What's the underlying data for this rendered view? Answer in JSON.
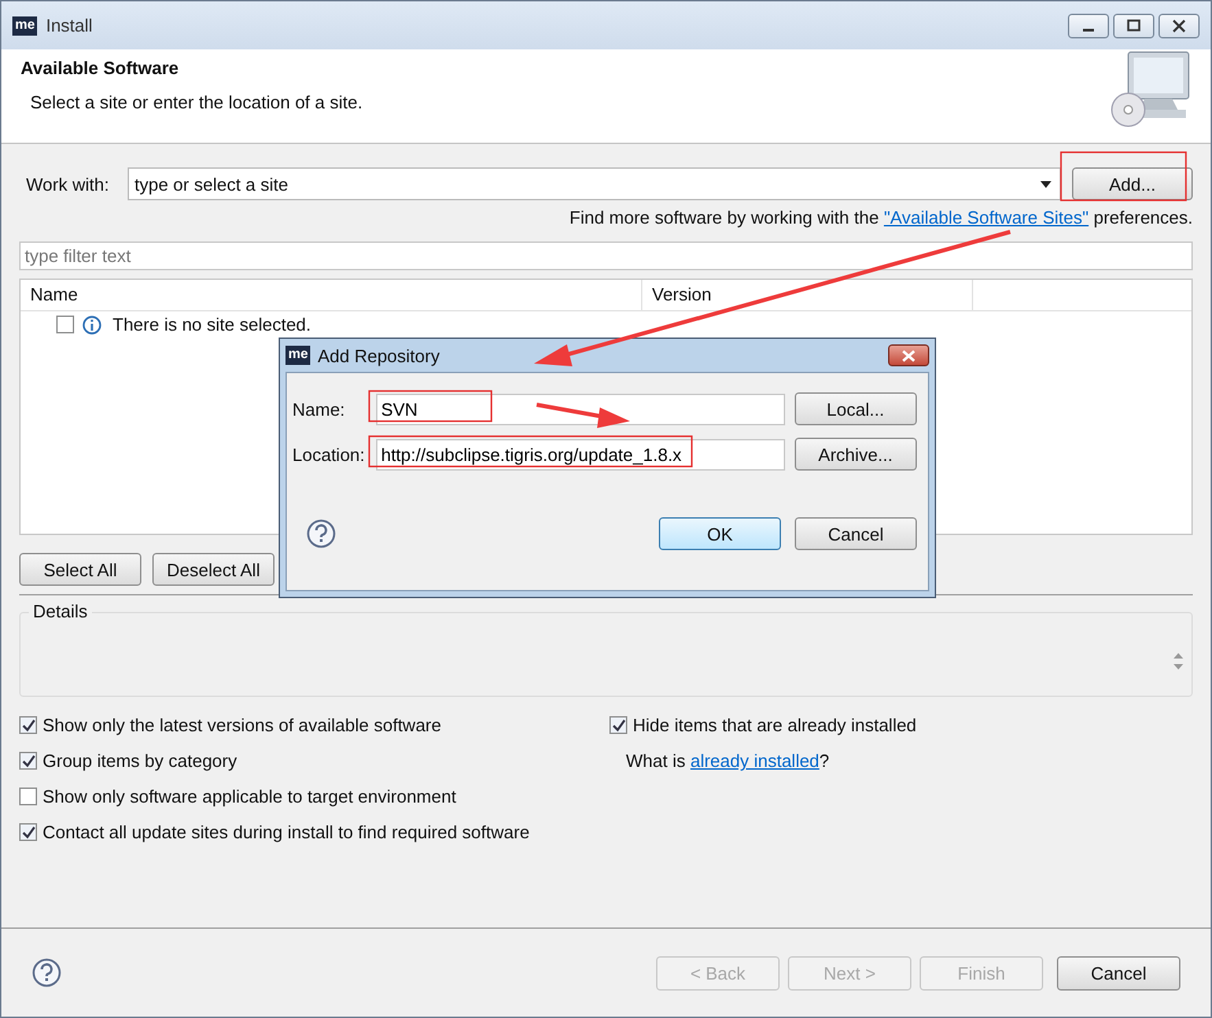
{
  "window": {
    "app_icon": "me",
    "title": "Install"
  },
  "header": {
    "title": "Available Software",
    "description": "Select a site or enter the location of a site."
  },
  "work_with": {
    "label": "Work with:",
    "placeholder": "type or select a site",
    "button": "Add..."
  },
  "info": {
    "before": "Find more software by working with the",
    "link": "\"Available Software Sites\"",
    "after": "preferences."
  },
  "filter": {
    "placeholder": "type filter text"
  },
  "table": {
    "columns": [
      "Name",
      "Version"
    ],
    "rows": [
      {
        "checked": false,
        "text": "There is no site selected."
      }
    ]
  },
  "selection_buttons": [
    "Select All",
    "Deselect All"
  ],
  "details": {
    "label": "Details"
  },
  "options": [
    {
      "checked": true,
      "label": "Show only the latest versions of available software"
    },
    {
      "checked": true,
      "label": "Hide items that are already installed"
    },
    {
      "checked": true,
      "label": "Group items by category"
    },
    {
      "kind": "link",
      "before": "What is",
      "link": "already installed",
      "after": "?"
    },
    {
      "checked": false,
      "label": "Show only software applicable to target environment"
    },
    {
      "checked": true,
      "label": "Contact all update sites during install to find required software"
    }
  ],
  "footer_buttons": [
    {
      "label": "< Back",
      "disabled": true
    },
    {
      "label": "Next >",
      "disabled": true
    },
    {
      "label": "Finish",
      "disabled": true
    },
    {
      "label": "Cancel",
      "disabled": false
    }
  ],
  "dialog": {
    "app_icon": "me",
    "title": "Add Repository",
    "fields": [
      {
        "label": "Name:",
        "value": "SVN",
        "button": "Local..."
      },
      {
        "label": "Location:",
        "value": "http://subclipse.tigris.org/update_1.8.x",
        "button": "Archive..."
      }
    ],
    "buttons": [
      {
        "label": "OK",
        "default": true
      },
      {
        "label": "Cancel",
        "default": false
      }
    ]
  }
}
